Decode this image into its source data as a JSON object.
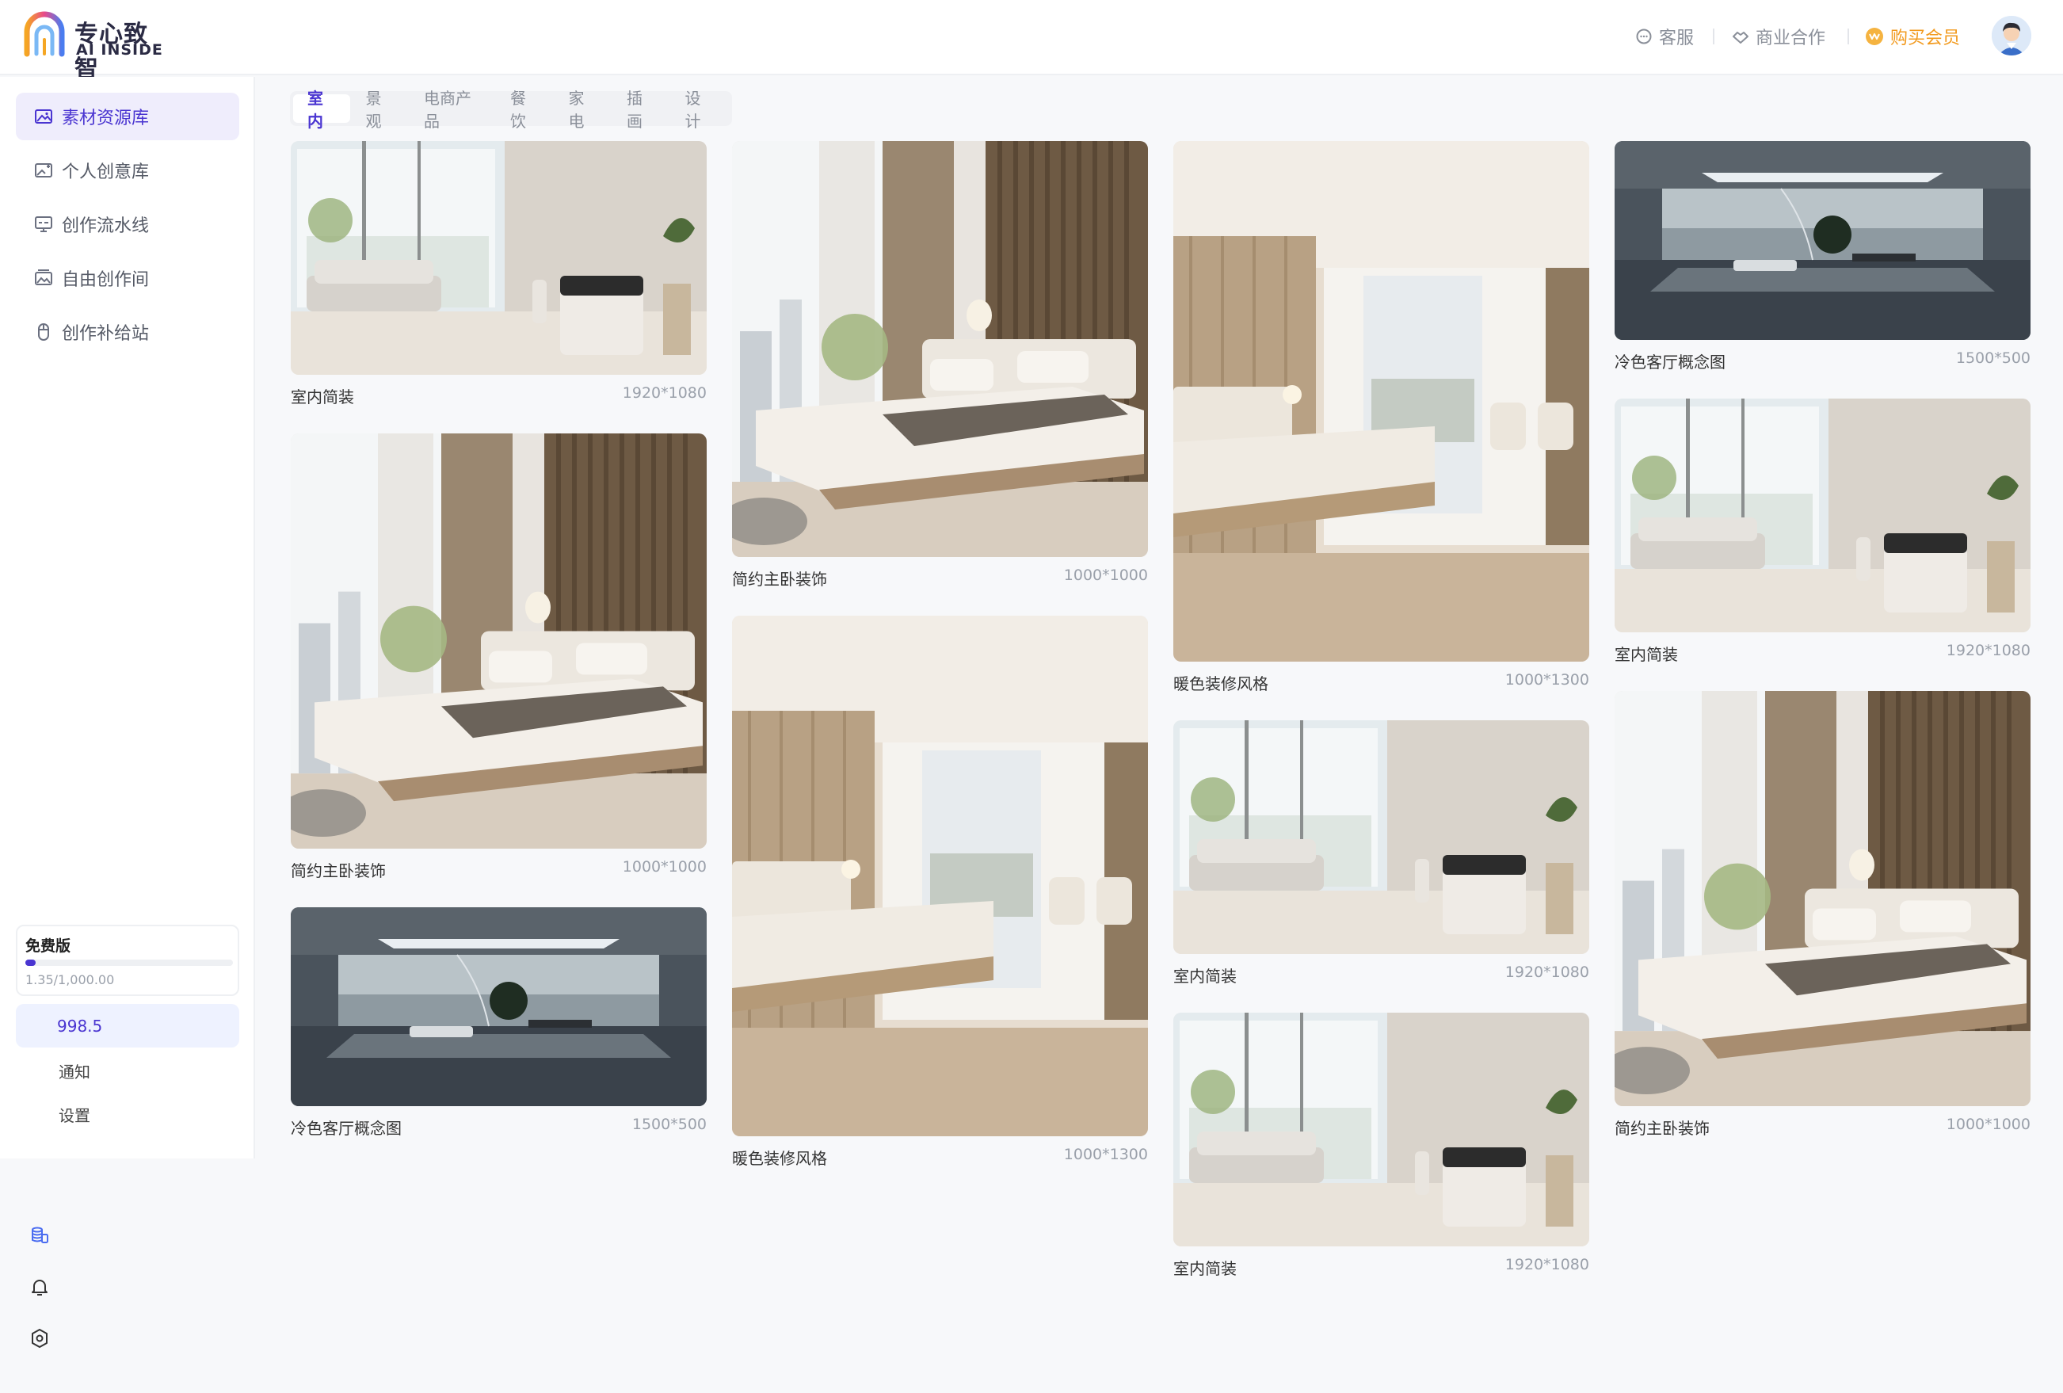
{
  "brand": {
    "name_cn": "专心致智",
    "name_en": "AI INSIDE"
  },
  "header": {
    "support": "客服",
    "business": "商业合作",
    "vip": "购买会员"
  },
  "sidebar": {
    "items": [
      {
        "label": "素材资源库",
        "icon": "image-library-icon",
        "active": true
      },
      {
        "label": "个人创意库",
        "icon": "personal-library-icon",
        "active": false
      },
      {
        "label": "创作流水线",
        "icon": "pipeline-icon",
        "active": false
      },
      {
        "label": "自由创作间",
        "icon": "free-studio-icon",
        "active": false
      },
      {
        "label": "创作补给站",
        "icon": "supply-icon",
        "active": false
      }
    ],
    "plan": {
      "name": "免费版",
      "usage": "1.35/1,000.00",
      "progress": 0.05
    },
    "credits": "998.5",
    "notify": "通知",
    "settings": "设置"
  },
  "tabs": [
    {
      "label": "室内",
      "active": true
    },
    {
      "label": "景观",
      "active": false
    },
    {
      "label": "电商产品",
      "active": false
    },
    {
      "label": "餐饮",
      "active": false
    },
    {
      "label": "家电",
      "active": false
    },
    {
      "label": "插画",
      "active": false
    },
    {
      "label": "设计",
      "active": false
    }
  ],
  "gallery": [
    {
      "title": "室内简装",
      "size": "1920*1080",
      "scene": "living-room"
    },
    {
      "title": "简约主卧装饰",
      "size": "1000*1000",
      "scene": "bedroom"
    },
    {
      "title": "冷色客厅概念图",
      "size": "1500*500",
      "scene": "cold-living"
    },
    {
      "title": "简约主卧装饰",
      "size": "1000*1000",
      "scene": "bedroom"
    },
    {
      "title": "暖色装修风格",
      "size": "1000*1300",
      "scene": "warm-bedroom"
    },
    {
      "title": "暖色装修风格",
      "size": "1000*1300",
      "scene": "warm-bedroom"
    },
    {
      "title": "室内简装",
      "size": "1920*1080",
      "scene": "living-room"
    },
    {
      "title": "室内简装",
      "size": "1920*1080",
      "scene": "living-room"
    },
    {
      "title": "冷色客厅概念图",
      "size": "1500*500",
      "scene": "cold-living"
    },
    {
      "title": "室内简装",
      "size": "1920*1080",
      "scene": "living-room"
    },
    {
      "title": "简约主卧装饰",
      "size": "1000*1000",
      "scene": "bedroom"
    }
  ],
  "colors": {
    "accent": "#4a35d1",
    "vip": "#f29a1e"
  }
}
